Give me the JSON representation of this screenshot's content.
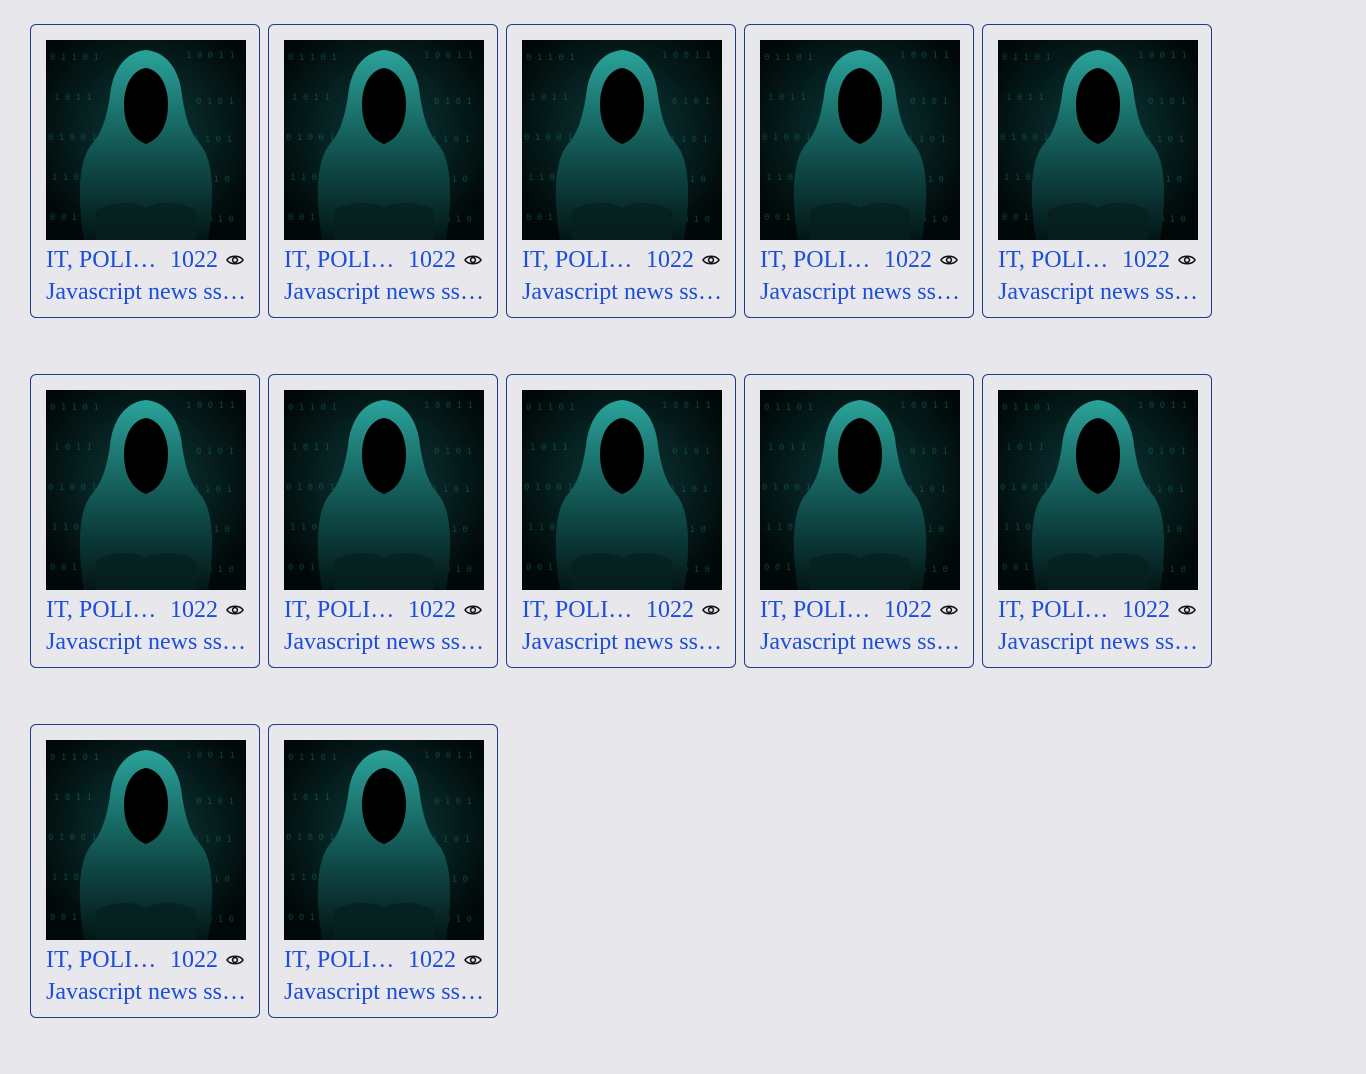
{
  "cards": [
    {
      "category": "IT, POLITICS",
      "views": "1022",
      "title": "Javascript news ssssss"
    },
    {
      "category": "IT, POLITICS",
      "views": "1022",
      "title": "Javascript news ssssss"
    },
    {
      "category": "IT, POLITICS",
      "views": "1022",
      "title": "Javascript news ssssss"
    },
    {
      "category": "IT, POLITICS",
      "views": "1022",
      "title": "Javascript news ssssss"
    },
    {
      "category": "IT, POLITICS",
      "views": "1022",
      "title": "Javascript news ssssss"
    },
    {
      "category": "IT, POLITICS",
      "views": "1022",
      "title": "Javascript news ssssss"
    },
    {
      "category": "IT, POLITICS",
      "views": "1022",
      "title": "Javascript news ssssss"
    },
    {
      "category": "IT, POLITICS",
      "views": "1022",
      "title": "Javascript news ssssss"
    },
    {
      "category": "IT, POLITICS",
      "views": "1022",
      "title": "Javascript news ssssss"
    },
    {
      "category": "IT, POLITICS",
      "views": "1022",
      "title": "Javascript news ssssss"
    },
    {
      "category": "IT, POLITICS",
      "views": "1022",
      "title": "Javascript news ssssss"
    },
    {
      "category": "IT, POLITICS",
      "views": "1022",
      "title": "Javascript news ssssss"
    }
  ],
  "colors": {
    "accent": "#1d4ed8",
    "border": "#1e3a8a",
    "background": "#e8e8ec",
    "thumb_bg": "#021414",
    "thumb_glow": "#2dd4bf"
  },
  "icons": {
    "views": "eye-icon",
    "thumbnail": "hooded-hacker-image"
  }
}
